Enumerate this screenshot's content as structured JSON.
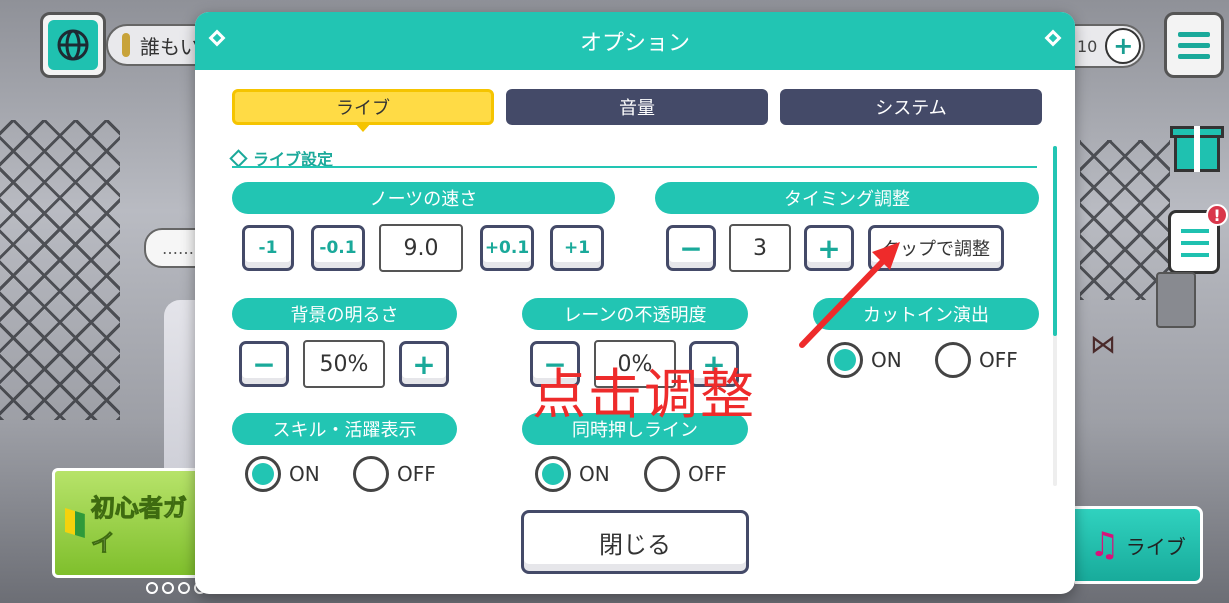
{
  "topbar": {
    "status_text": "誰もい",
    "counter_text": "10",
    "counter_plus": "+",
    "alert_badge": "!",
    "speech_text": "……"
  },
  "dialog": {
    "title": "オプション",
    "tabs": [
      {
        "label": "ライブ",
        "active": true
      },
      {
        "label": "音量",
        "active": false
      },
      {
        "label": "システム",
        "active": false
      }
    ],
    "section_title": "ライブ設定",
    "note_speed": {
      "label": "ノーツの速さ",
      "buttons": [
        "-1",
        "-0.1",
        "+0.1",
        "+1"
      ],
      "value": "9.0"
    },
    "timing": {
      "label": "タイミング調整",
      "minus": "−",
      "plus": "+",
      "value": "3",
      "tap_adjust_label": "タップで調整"
    },
    "background_brightness": {
      "label": "背景の明るさ",
      "minus": "−",
      "plus": "+",
      "value": "50%"
    },
    "lane_opacity": {
      "label": "レーンの不透明度",
      "minus": "−",
      "plus": "+",
      "value": "0%"
    },
    "cut_in": {
      "label": "カットイン演出",
      "on_label": "ON",
      "off_label": "OFF",
      "selected": "ON"
    },
    "skill_display": {
      "label": "スキル・活躍表示",
      "on_label": "ON",
      "off_label": "OFF",
      "selected": "ON"
    },
    "simultaneous_line": {
      "label": "同時押しライン",
      "on_label": "ON",
      "off_label": "OFF",
      "selected": "ON"
    },
    "close_label": "閉じる"
  },
  "footer": {
    "beginner_guide": "初心者ガイ",
    "live_button": "ライブ"
  },
  "annotation": {
    "text": "点击调整",
    "color": "#ee2b2b"
  },
  "colors": {
    "accent": "#22c5b3",
    "tab_active": "#ffdb45",
    "tab_inactive": "#444a68"
  }
}
